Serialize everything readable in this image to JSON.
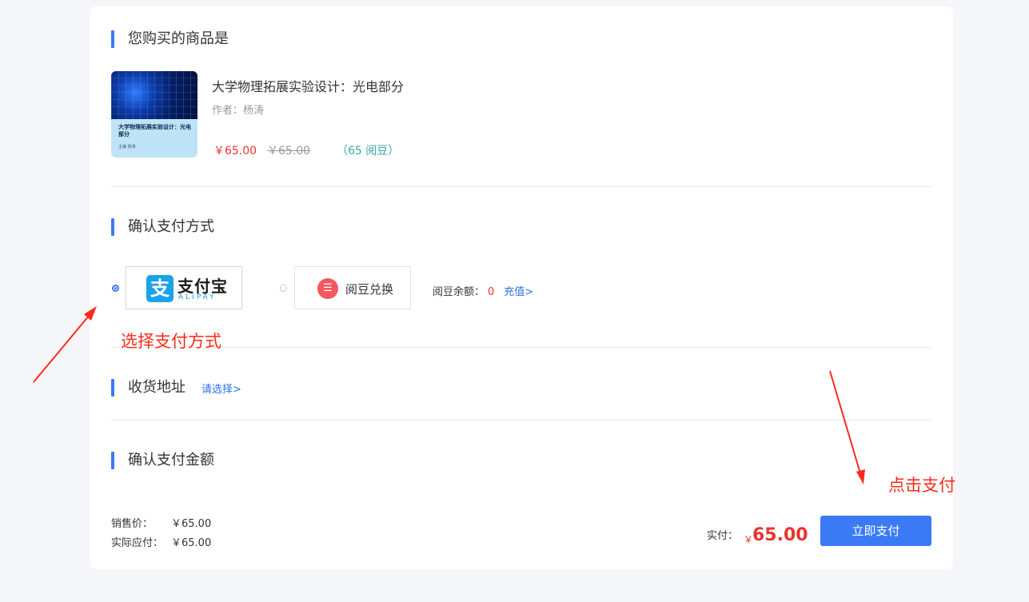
{
  "product_section": {
    "title": "您购买的商品是"
  },
  "book": {
    "title": "大学物理拓展实验设计：光电部分",
    "author": "作者：杨涛",
    "price": "￥65.00",
    "original_price": "￥65.00",
    "beans": "（65 阅豆）",
    "cover_title": "大学物理拓展实验设计：光电部分",
    "cover_author": "主编 杨涛"
  },
  "payment_section": {
    "title": "确认支付方式",
    "alipay": {
      "brand": "支付宝",
      "sub": "ALIPAY",
      "logo": "支",
      "icon": "alipay-icon",
      "selected": true
    },
    "beans": {
      "label": "阅豆兑换",
      "icon": "bean-stack-icon",
      "selected": false
    },
    "balance_label": "阅豆余额：",
    "balance_value": "0",
    "recharge_link": "充值>"
  },
  "address_section": {
    "title": "收货地址",
    "select_link": "请选择>"
  },
  "amount_section": {
    "title": "确认支付金额",
    "sale_price_label": "销售价：",
    "sale_price_value": "￥65.00",
    "payable_label": "实际应付：",
    "payable_value": "￥65.00",
    "actual_label": "实付：",
    "currency": "￥",
    "actual_value": "65.00",
    "pay_button": "立即支付"
  },
  "annotations": {
    "choose_payment": "选择支付方式",
    "click_pay": "点击支付",
    "color": "#ff2a1a"
  },
  "colors": {
    "accent": "#3a7bf5",
    "price": "#e8352e",
    "link": "#2c6fe8",
    "beans": "#3aa7a3"
  }
}
